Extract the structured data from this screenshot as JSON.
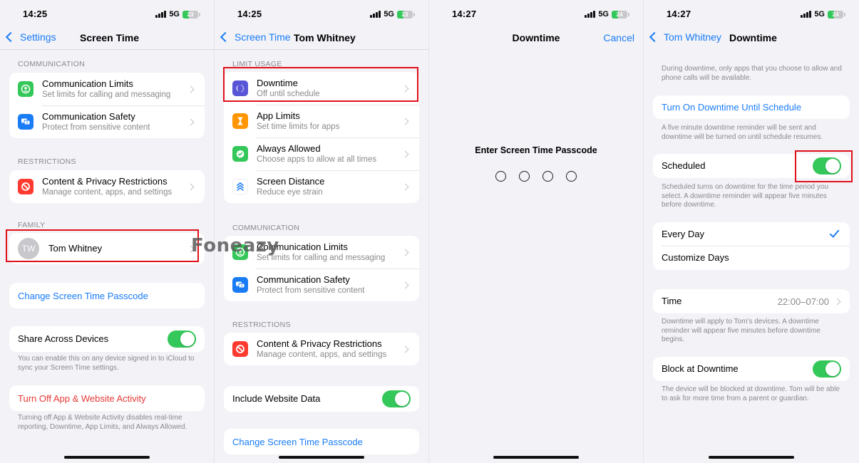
{
  "watermark": "Foneazy",
  "colors": {
    "accent": "#1a7cf5",
    "toggle_on": "#34c759",
    "destructive": "#e53935",
    "highlight": "#e0101a"
  },
  "panels": [
    {
      "status": {
        "time": "14:25",
        "network": "5G",
        "battery": "23"
      },
      "nav": {
        "back_label": "Settings",
        "title": "Screen Time"
      },
      "sections": {
        "communication": {
          "header": "COMMUNICATION",
          "items": [
            {
              "icon": "communication-limits-icon",
              "title": "Communication Limits",
              "subtitle": "Set limits for calling and messaging"
            },
            {
              "icon": "communication-safety-icon",
              "title": "Communication Safety",
              "subtitle": "Protect from sensitive content"
            }
          ]
        },
        "restrictions": {
          "header": "RESTRICTIONS",
          "items": [
            {
              "icon": "restrictions-icon",
              "title": "Content & Privacy Restrictions",
              "subtitle": "Manage content, apps, and settings"
            }
          ]
        },
        "family": {
          "header": "FAMILY",
          "member": {
            "initials": "TW",
            "name": "Tom Whitney"
          }
        }
      },
      "change_passcode": "Change Screen Time Passcode",
      "share_across_devices": {
        "label": "Share Across Devices",
        "on": true,
        "footnote": "You can enable this on any device signed in to iCloud to sync your Screen Time settings."
      },
      "turn_off": {
        "label": "Turn Off App & Website Activity",
        "footnote": "Turning off App & Website Activity disables real-time reporting, Downtime, App Limits, and Always Allowed."
      }
    },
    {
      "status": {
        "time": "14:25",
        "network": "5G",
        "battery": "23"
      },
      "nav": {
        "back_label": "Screen Time",
        "title": "Tom Whitney"
      },
      "sections": {
        "limit_usage": {
          "header": "LIMIT USAGE",
          "items": [
            {
              "icon": "downtime-icon",
              "title": "Downtime",
              "subtitle": "Off until schedule"
            },
            {
              "icon": "app-limits-icon",
              "title": "App Limits",
              "subtitle": "Set time limits for apps"
            },
            {
              "icon": "always-allowed-icon",
              "title": "Always Allowed",
              "subtitle": "Choose apps to allow at all times"
            },
            {
              "icon": "screen-distance-icon",
              "title": "Screen Distance",
              "subtitle": "Reduce eye strain"
            }
          ]
        },
        "communication": {
          "header": "COMMUNICATION",
          "items": [
            {
              "icon": "communication-limits-icon",
              "title": "Communication Limits",
              "subtitle": "Set limits for calling and messaging"
            },
            {
              "icon": "communication-safety-icon",
              "title": "Communication Safety",
              "subtitle": "Protect from sensitive content"
            }
          ]
        },
        "restrictions": {
          "header": "RESTRICTIONS",
          "items": [
            {
              "icon": "restrictions-icon",
              "title": "Content & Privacy Restrictions",
              "subtitle": "Manage content, apps, and settings"
            }
          ]
        }
      },
      "include_website_data": {
        "label": "Include Website Data",
        "on": true
      },
      "change_passcode": "Change Screen Time Passcode"
    },
    {
      "status": {
        "time": "14:27",
        "network": "5G",
        "battery": "24"
      },
      "nav": {
        "title": "Downtime",
        "cancel_label": "Cancel"
      },
      "passcode": {
        "prompt": "Enter Screen Time Passcode",
        "digits_entered": 0,
        "digits_total": 4
      }
    },
    {
      "status": {
        "time": "14:27",
        "network": "5G",
        "battery": "24"
      },
      "nav": {
        "back_label": "Tom Whitney",
        "title": "Downtime"
      },
      "intro": "During downtime, only apps that you choose to allow and phone calls will be available.",
      "turn_on_until_schedule": {
        "label": "Turn On Downtime Until Schedule",
        "footnote": "A five minute downtime reminder will be sent and downtime will be turned on until schedule resumes."
      },
      "scheduled": {
        "label": "Scheduled",
        "on": true,
        "footnote": "Scheduled turns on downtime for the time period you select. A downtime reminder will appear five minutes before downtime."
      },
      "days": {
        "options": [
          "Every Day",
          "Customize Days"
        ],
        "selected": "Every Day"
      },
      "time": {
        "label": "Time",
        "value": "22:00–07:00",
        "footnote": "Downtime will apply to Tom’s devices. A downtime reminder will appear five minutes before downtime begins."
      },
      "block_at_downtime": {
        "label": "Block at Downtime",
        "on": true,
        "footnote": "The device will be blocked at downtime. Tom will be able to ask for more time from a parent or guardian."
      }
    }
  ]
}
